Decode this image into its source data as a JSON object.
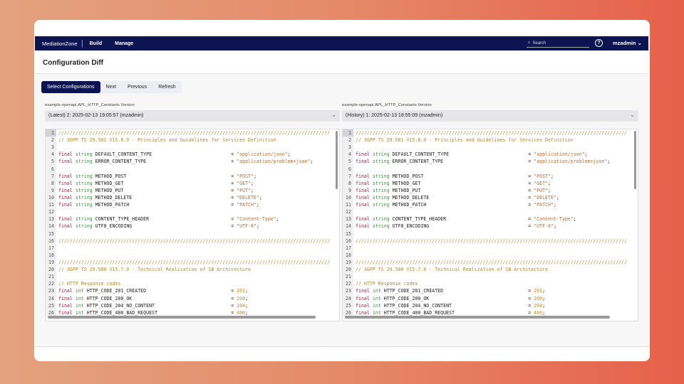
{
  "nav": {
    "brand": "MediationZone",
    "links": [
      "Build",
      "Manage"
    ],
    "search_placeholder": "Search",
    "user": "mzadmin"
  },
  "page_title": "Configuration Diff",
  "toolbar": {
    "select": "Select Configurations",
    "next": "Next",
    "previous": "Previous",
    "refresh": "Refresh"
  },
  "left": {
    "label": "example-openapi.APL_HTTP_Constants Version",
    "selected": "(Latest) 2: 2025-02-13 19:05:57 (mzadmin)"
  },
  "right": {
    "label": "example-openapi.APL_HTTP_Constants Version",
    "selected": "(History) 1: 2025-02-13 18:55:09 (mzadmin)"
  },
  "code": [
    {
      "c": "////////////////////////////////////////////////////////////////////////////////////////////////"
    },
    {
      "c": "// 3GPP TS 29.501 V15.8.0 - Principles and Guidelines for Services Definition"
    },
    {},
    {
      "k": "final",
      "t": "string",
      "n": "DEFAULT_CONTENT_TYPE",
      "v": "\"application/json\"",
      "vt": "s"
    },
    {
      "k": "final",
      "t": "string",
      "n": "ERROR_CONTENT_TYPE",
      "v": "\"application/problem+json\"",
      "vt": "s"
    },
    {},
    {
      "k": "final",
      "t": "string",
      "n": "METHOD_POST",
      "v": "\"POST\"",
      "vt": "s"
    },
    {
      "k": "final",
      "t": "string",
      "n": "METHOD_GET",
      "v": "\"GET\"",
      "vt": "s"
    },
    {
      "k": "final",
      "t": "string",
      "n": "METHOD_PUT",
      "v": "\"PUT\"",
      "vt": "s"
    },
    {
      "k": "final",
      "t": "string",
      "n": "METHOD_DELETE",
      "v": "\"DELETE\"",
      "vt": "s"
    },
    {
      "k": "final",
      "t": "string",
      "n": "METHOD_PATCH",
      "v": "\"PATCH\"",
      "vt": "s"
    },
    {},
    {
      "k": "final",
      "t": "string",
      "n": "CONTENT_TYPE_HEADER",
      "v": "\"Content-Type\"",
      "vt": "s"
    },
    {
      "k": "final",
      "t": "string",
      "n": "UTF8_ENCODING",
      "v": "\"UTF-8\"",
      "vt": "s"
    },
    {},
    {
      "c": "////////////////////////////////////////////////////////////////////////////////////////////////"
    },
    {},
    {},
    {
      "c": "////////////////////////////////////////////////////////////////////////////////////////////////"
    },
    {
      "c": "// 3GPP TS 29.500 V15.7.0 - Technical Realization of SB Architecture"
    },
    {},
    {
      "c": "// HTTP Response codes"
    },
    {
      "k": "final",
      "t": "int",
      "n": "HTTP_CODE_201_CREATED",
      "v": "201",
      "vt": "n"
    },
    {
      "k": "final",
      "t": "int",
      "n": "HTTP_CODE_200_OK",
      "v": "200",
      "vt": "n"
    },
    {
      "k": "final",
      "t": "int",
      "n": "HTTP_CODE_204_NO_CONTENT",
      "v": "204",
      "vt": "n"
    },
    {
      "k": "final",
      "t": "int",
      "n": "HTTP_CODE_400_BAD_REQUEST",
      "v": "400",
      "vt": "n"
    }
  ]
}
